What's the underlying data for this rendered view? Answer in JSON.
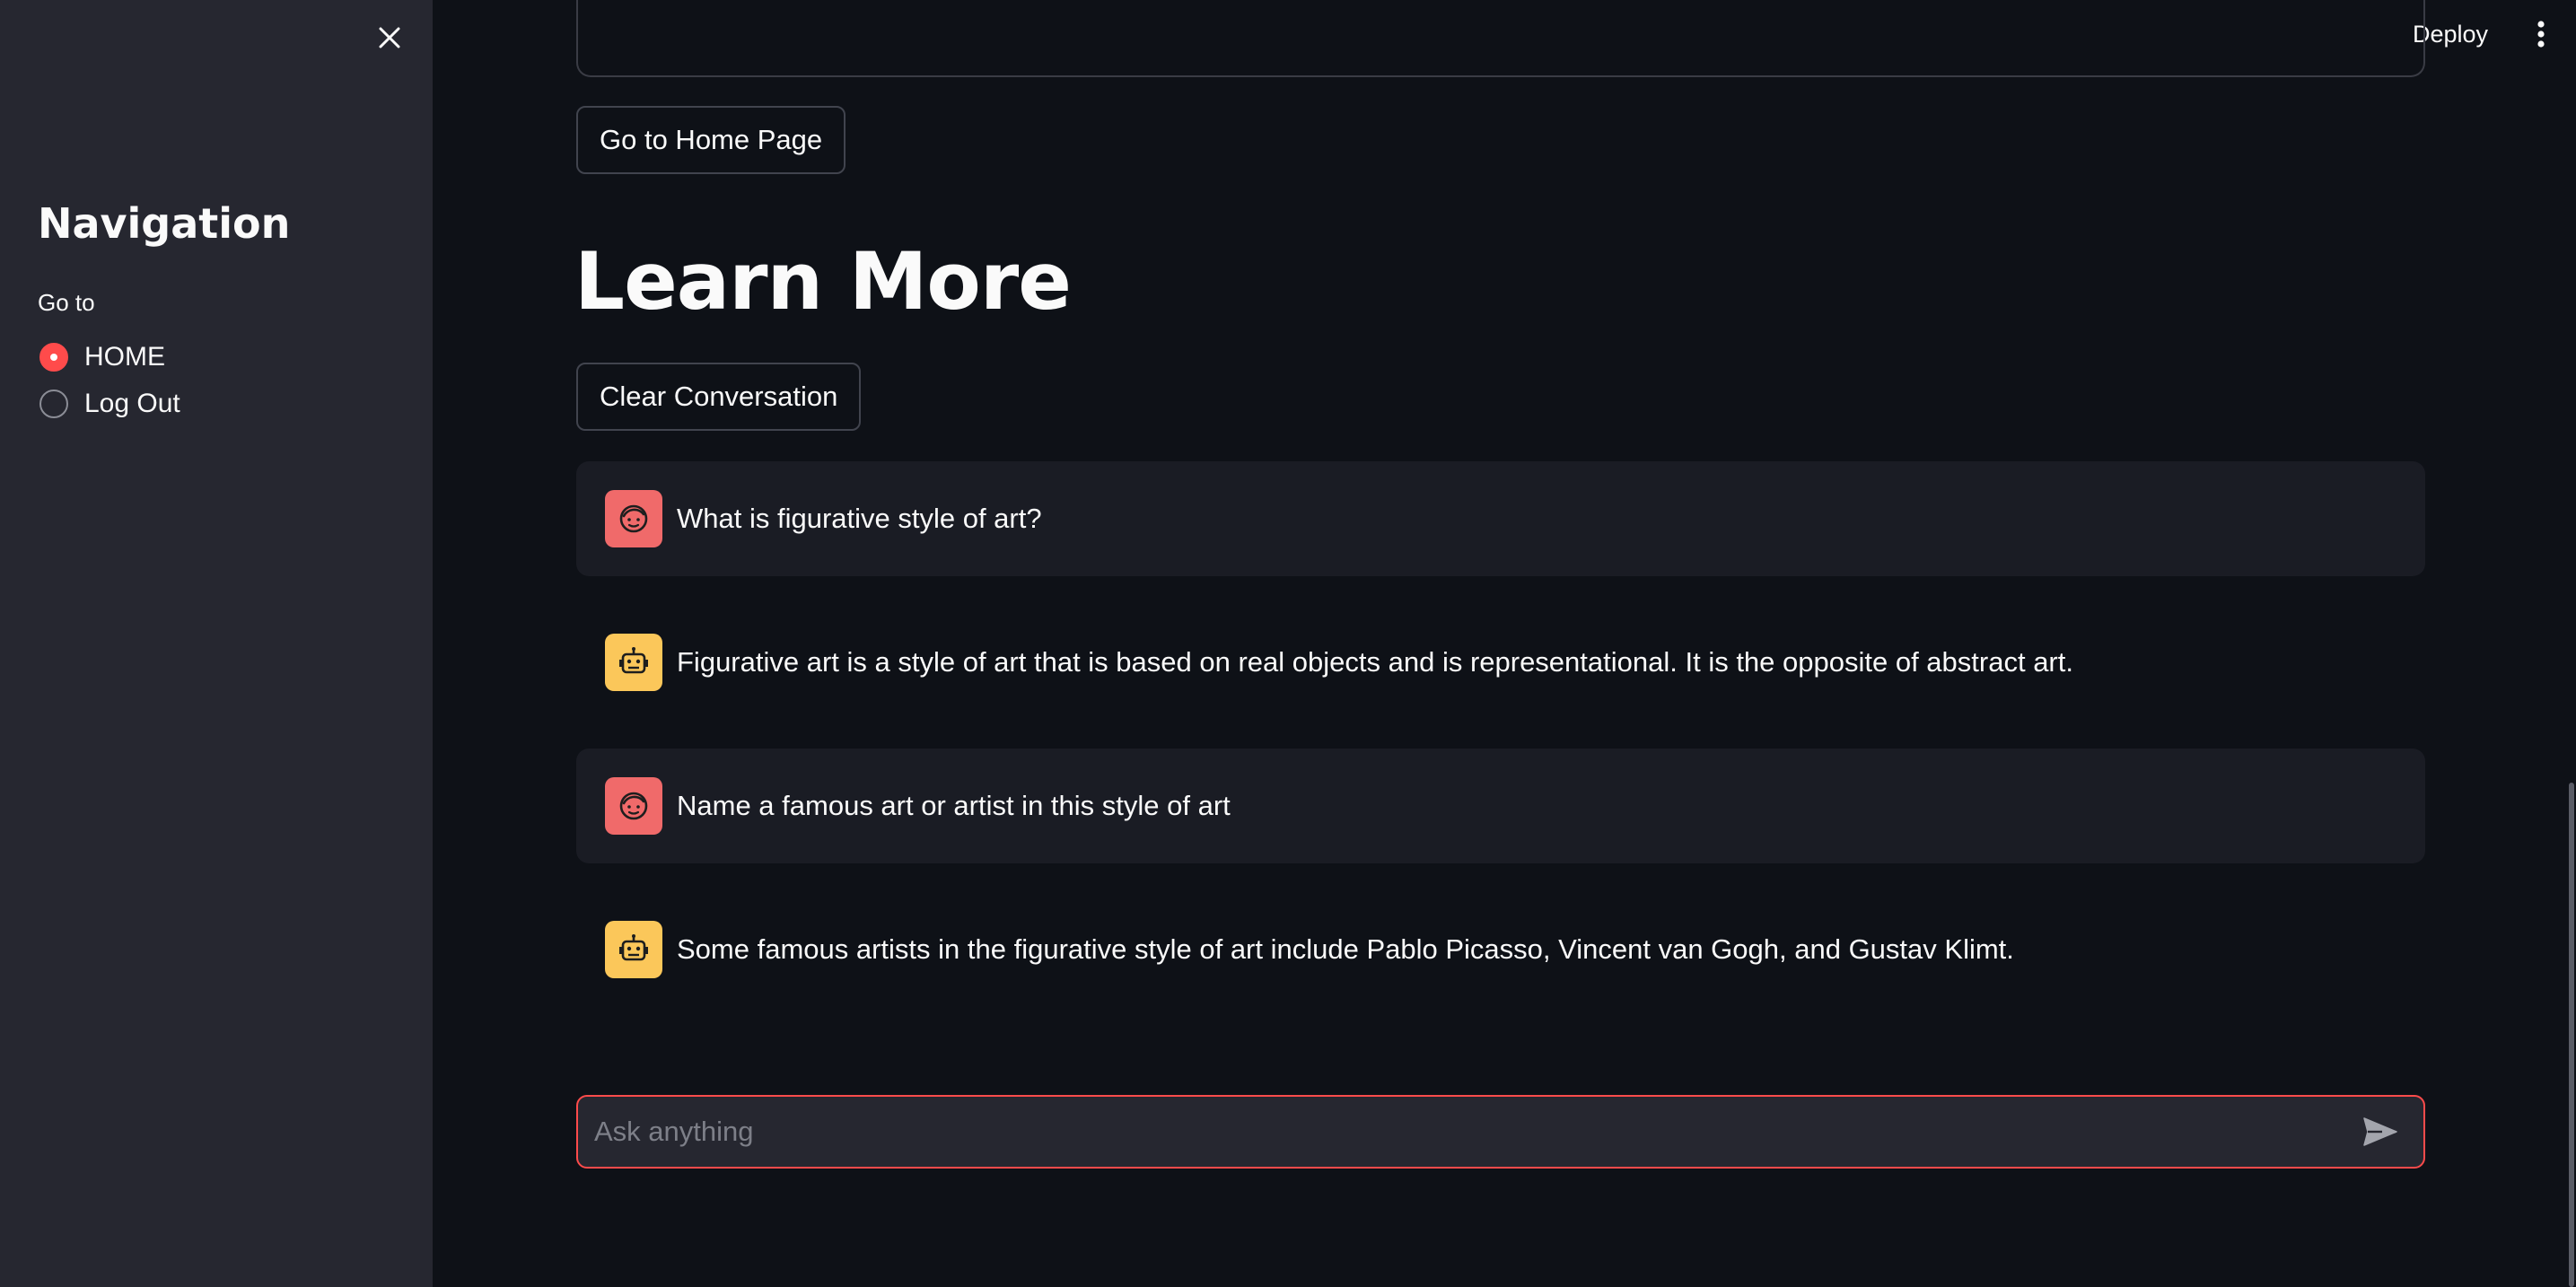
{
  "sidebar": {
    "title": "Navigation",
    "radio_label": "Go to",
    "options": [
      {
        "label": "HOME",
        "checked": true
      },
      {
        "label": "Log Out",
        "checked": false
      }
    ]
  },
  "header": {
    "deploy_label": "Deploy"
  },
  "main": {
    "home_button_label": "Go to Home Page",
    "title": "Learn More",
    "clear_button_label": "Clear Conversation",
    "messages": [
      {
        "role": "user",
        "text": "What is figurative style of art?"
      },
      {
        "role": "assistant",
        "text": "Figurative art is a style of art that is based on real objects and is representational. It is the opposite of abstract art."
      },
      {
        "role": "user",
        "text": "Name a famous art or artist in this style of art"
      },
      {
        "role": "assistant",
        "text": "Some famous artists in the figurative style of art include Pablo Picasso, Vincent van Gogh, and Gustav Klimt."
      }
    ],
    "chat_input": {
      "placeholder": "Ask anything",
      "value": ""
    }
  },
  "colors": {
    "background": "#0e1117",
    "sidebar": "#262730",
    "accent": "#ff4b4b",
    "user_avatar": "#f06a6a",
    "assistant_avatar": "#fbc75a"
  },
  "icons": {
    "close": "close-icon",
    "menu": "more-vertical-icon",
    "user_avatar": "user-face-icon",
    "assistant_avatar": "robot-icon",
    "send": "send-icon"
  }
}
